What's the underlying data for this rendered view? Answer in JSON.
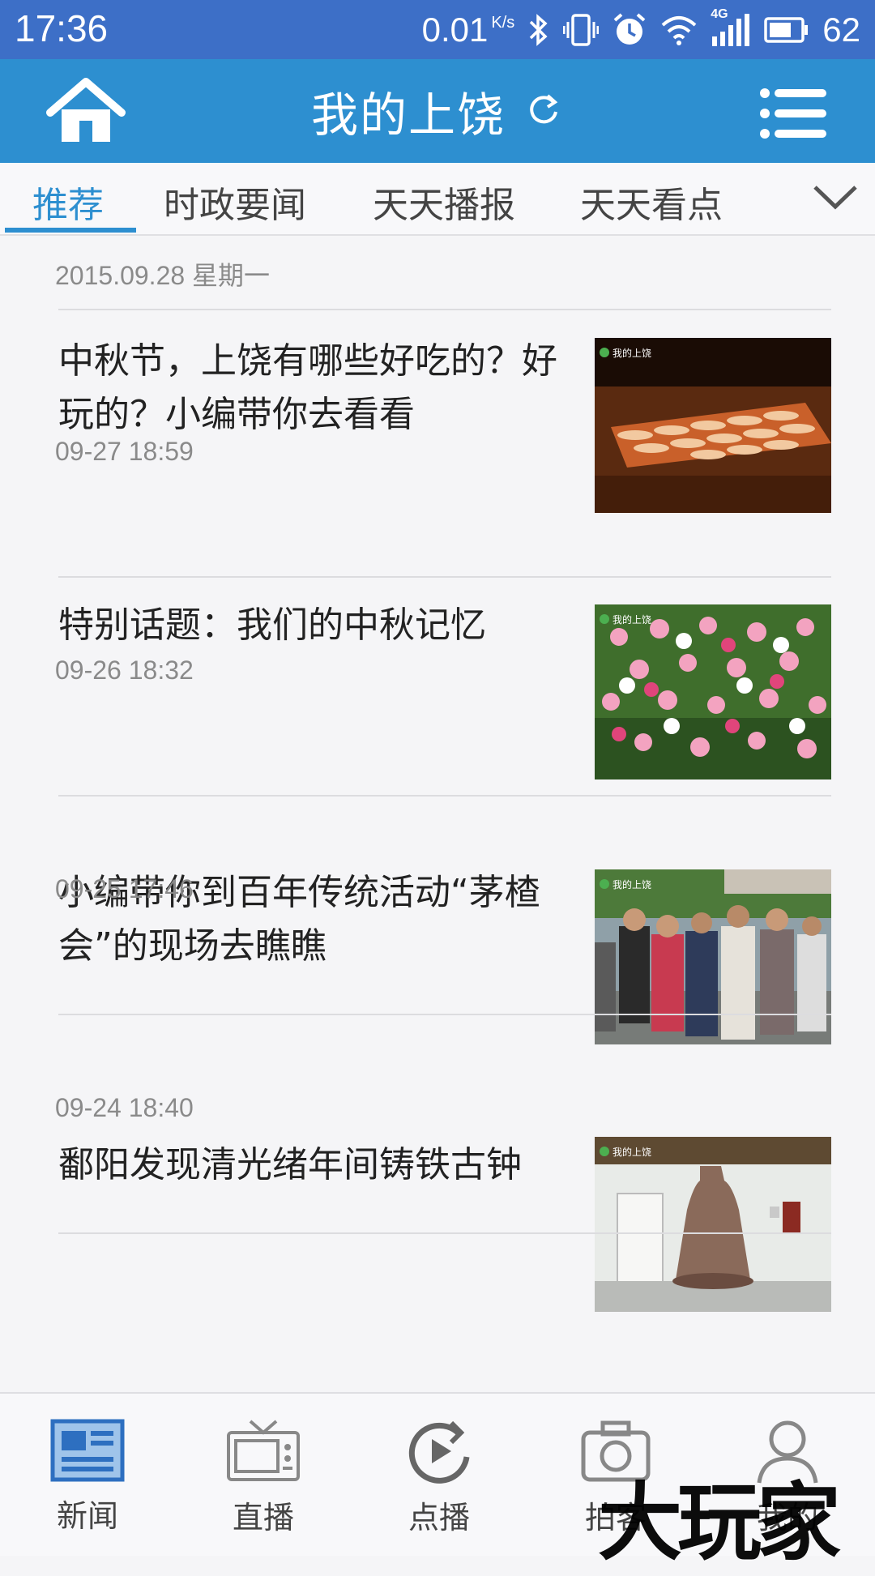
{
  "status_bar": {
    "time": "17:36",
    "speed": "0.01",
    "speed_unit": "K/s",
    "network": "4G",
    "battery": "62"
  },
  "app_bar": {
    "title": "我的上饶",
    "home_icon": "home-icon",
    "refresh_icon": "refresh-icon",
    "menu_icon": "menu-icon"
  },
  "tabs": [
    {
      "label": "推荐",
      "active": true
    },
    {
      "label": "时政要闻",
      "active": false
    },
    {
      "label": "天天播报",
      "active": false
    },
    {
      "label": "天天看点",
      "active": false
    }
  ],
  "feed": {
    "top_date": "2015.09.28 星期一",
    "items": [
      {
        "title": "中秋节，上饶有哪些好吃的？好玩的？小编带你去看看",
        "time": "09-27 18:59",
        "thumb_caption": "我的上饶"
      },
      {
        "title": "特别话题：我们的中秋记忆",
        "time": "09-26 18:32",
        "thumb_caption": "我的上饶"
      },
      {
        "title": "小编带你到百年传统活动“茅楂会”的现场去瞧瞧",
        "time": "09-25 17:46",
        "thumb_caption": "我的上饶"
      },
      {
        "title": "鄱阳发现清光绪年间铸铁古钟",
        "time": "09-24 18:40",
        "thumb_caption": "我的上饶"
      }
    ]
  },
  "bottom_nav": [
    {
      "label": "新闻",
      "icon": "news-icon",
      "active": true
    },
    {
      "label": "直播",
      "icon": "tv-icon",
      "active": false
    },
    {
      "label": "点播",
      "icon": "play-icon",
      "active": false
    },
    {
      "label": "拍客",
      "icon": "camera-icon",
      "active": false
    },
    {
      "label": "我的",
      "icon": "user-icon",
      "active": false
    }
  ],
  "watermark": "大玩家",
  "colors": {
    "status_bar": "#3d6fc7",
    "app_bar": "#2d8fd0",
    "accent": "#2d8fd0"
  }
}
